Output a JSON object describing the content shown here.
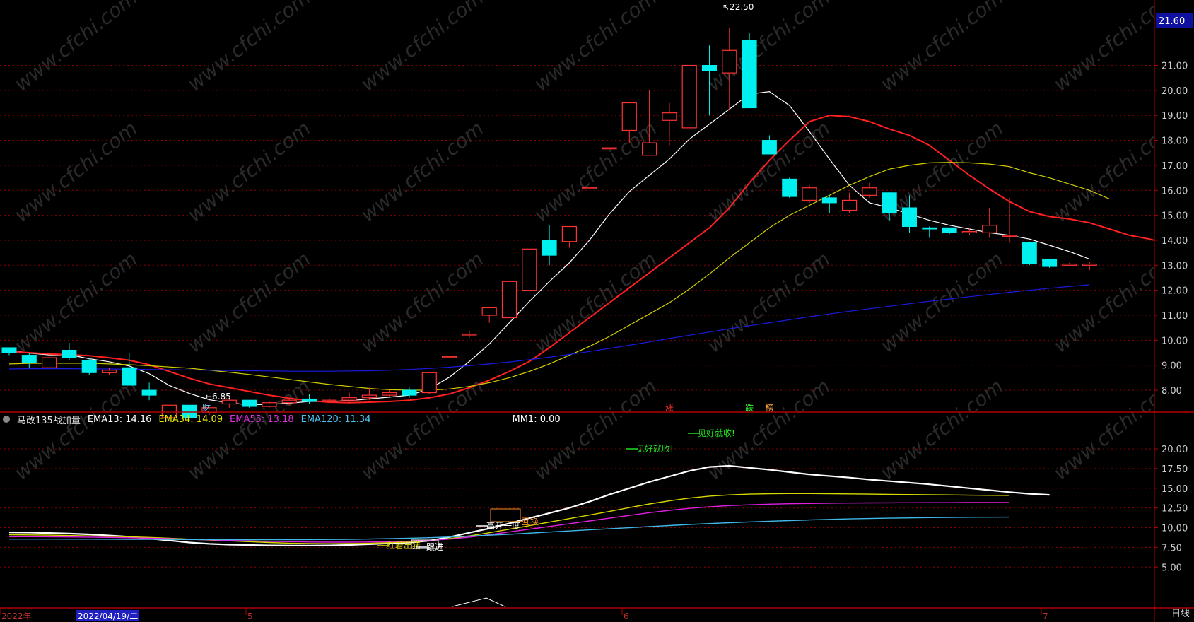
{
  "chart_data": [
    {
      "type": "candlestick",
      "price_axis": {
        "ticks": [
          "21.00",
          "20.00",
          "19.00",
          "18.00",
          "17.00",
          "16.00",
          "15.00",
          "14.00",
          "13.00",
          "12.00",
          "11.00",
          "10.00",
          "9.00",
          "8.00"
        ],
        "tick_values": [
          21,
          20,
          19,
          18,
          17,
          16,
          15,
          14,
          13,
          12,
          11,
          10,
          9,
          8
        ],
        "current_price": "21.60",
        "range": [
          6.4,
          22.8
        ]
      },
      "annotations": {
        "high": "22.50",
        "low": "6.85"
      },
      "candles": [
        {
          "o": 9.7,
          "c": 9.5,
          "h": 9.7,
          "l": 9.4
        },
        {
          "o": 9.4,
          "c": 9.1,
          "h": 9.5,
          "l": 8.9
        },
        {
          "o": 8.9,
          "c": 9.3,
          "h": 9.4,
          "l": 8.8
        },
        {
          "o": 9.6,
          "c": 9.3,
          "h": 9.9,
          "l": 9.2
        },
        {
          "o": 9.2,
          "c": 8.7,
          "h": 9.3,
          "l": 8.6
        },
        {
          "o": 8.7,
          "c": 8.8,
          "h": 8.9,
          "l": 8.6
        },
        {
          "o": 8.9,
          "c": 8.2,
          "h": 9.5,
          "l": 8.2
        },
        {
          "o": 8.0,
          "c": 7.8,
          "h": 8.3,
          "l": 7.6
        },
        {
          "o": 6.9,
          "c": 7.4,
          "h": 7.4,
          "l": 6.9
        },
        {
          "o": 7.4,
          "c": 6.9,
          "h": 7.4,
          "l": 6.85
        },
        {
          "o": 7.1,
          "c": 7.3,
          "h": 7.3,
          "l": 7.0
        },
        {
          "o": 7.45,
          "c": 7.6,
          "h": 7.65,
          "l": 7.3
        },
        {
          "o": 7.6,
          "c": 7.35,
          "h": 7.6,
          "l": 7.3
        },
        {
          "o": 7.35,
          "c": 7.5,
          "h": 7.55,
          "l": 7.3
        },
        {
          "o": 7.5,
          "c": 7.6,
          "h": 7.7,
          "l": 7.4
        },
        {
          "o": 7.65,
          "c": 7.55,
          "h": 7.85,
          "l": 7.45
        },
        {
          "o": 7.55,
          "c": 7.6,
          "h": 7.7,
          "l": 7.45
        },
        {
          "o": 7.6,
          "c": 7.7,
          "h": 7.9,
          "l": 7.5
        },
        {
          "o": 7.7,
          "c": 7.8,
          "h": 8.1,
          "l": 7.6
        },
        {
          "o": 7.8,
          "c": 7.9,
          "h": 8.0,
          "l": 7.75
        },
        {
          "o": 8.0,
          "c": 7.8,
          "h": 8.1,
          "l": 7.7
        },
        {
          "o": 7.9,
          "c": 8.7,
          "h": 8.7,
          "l": 7.85
        },
        {
          "o": 9.35,
          "c": 9.35,
          "h": 9.35,
          "l": 9.35
        },
        {
          "o": 10.25,
          "c": 10.25,
          "h": 10.35,
          "l": 10.1
        },
        {
          "o": 11.0,
          "c": 11.3,
          "h": 11.3,
          "l": 10.7
        },
        {
          "o": 10.9,
          "c": 12.35,
          "h": 12.35,
          "l": 10.9
        },
        {
          "o": 12.0,
          "c": 13.65,
          "h": 13.65,
          "l": 12.0
        },
        {
          "o": 14.0,
          "c": 13.4,
          "h": 14.6,
          "l": 13.0
        },
        {
          "o": 13.95,
          "c": 14.55,
          "h": 14.55,
          "l": 13.7
        },
        {
          "o": 16.1,
          "c": 16.1,
          "h": 16.1,
          "l": 16.1
        },
        {
          "o": 17.7,
          "c": 17.7,
          "h": 17.7,
          "l": 17.7
        },
        {
          "o": 18.4,
          "c": 19.5,
          "h": 19.5,
          "l": 17.9
        },
        {
          "o": 17.4,
          "c": 17.9,
          "h": 20.0,
          "l": 17.4
        },
        {
          "o": 18.8,
          "c": 19.1,
          "h": 19.5,
          "l": 17.8
        },
        {
          "o": 18.5,
          "c": 21.0,
          "h": 21.0,
          "l": 18.5
        },
        {
          "o": 21.0,
          "c": 20.8,
          "h": 21.8,
          "l": 19.0
        },
        {
          "o": 20.7,
          "c": 21.6,
          "h": 22.5,
          "l": 19.2
        },
        {
          "o": 22.0,
          "c": 19.3,
          "h": 22.3,
          "l": 19.3
        },
        {
          "o": 18.0,
          "c": 17.45,
          "h": 18.2,
          "l": 17.45
        },
        {
          "o": 16.45,
          "c": 15.75,
          "h": 16.5,
          "l": 15.7
        },
        {
          "o": 15.6,
          "c": 16.1,
          "h": 16.2,
          "l": 15.5
        },
        {
          "o": 15.7,
          "c": 15.5,
          "h": 15.8,
          "l": 15.1
        },
        {
          "o": 15.2,
          "c": 15.6,
          "h": 15.9,
          "l": 15.1
        },
        {
          "o": 15.8,
          "c": 16.1,
          "h": 16.3,
          "l": 15.7
        },
        {
          "o": 15.9,
          "c": 15.1,
          "h": 15.95,
          "l": 14.8
        },
        {
          "o": 15.3,
          "c": 14.55,
          "h": 15.8,
          "l": 14.3
        },
        {
          "o": 14.5,
          "c": 14.45,
          "h": 14.55,
          "l": 14.1
        },
        {
          "o": 14.5,
          "c": 14.3,
          "h": 14.5,
          "l": 14.25
        },
        {
          "o": 14.3,
          "c": 14.35,
          "h": 14.5,
          "l": 14.2
        },
        {
          "o": 14.3,
          "c": 14.6,
          "h": 15.3,
          "l": 14.1
        },
        {
          "o": 14.2,
          "c": 14.2,
          "h": 15.7,
          "l": 13.9
        },
        {
          "o": 13.9,
          "c": 13.05,
          "h": 13.95,
          "l": 13.0
        },
        {
          "o": 13.25,
          "c": 12.95,
          "h": 13.25,
          "l": 12.9
        },
        {
          "o": 13.0,
          "c": 13.05,
          "h": 13.1,
          "l": 12.95
        },
        {
          "o": 13.0,
          "c": 13.05,
          "h": 13.15,
          "l": 12.8
        }
      ],
      "moving_averages": [
        {
          "color": "#ffffff",
          "values": [
            9.62,
            9.48,
            9.41,
            9.42,
            9.26,
            9.14,
            8.97,
            8.66,
            8.19,
            7.87,
            7.62,
            7.49,
            7.42,
            7.43,
            7.48,
            7.55,
            7.55,
            7.58,
            7.65,
            7.72,
            7.8,
            8.05,
            8.52,
            9.15,
            9.85,
            10.7,
            11.55,
            12.35,
            13.1,
            14.0,
            15.05,
            15.95,
            16.6,
            17.25,
            18.05,
            18.65,
            19.25,
            19.85,
            19.95,
            19.4,
            18.35,
            17.25,
            16.2,
            15.5,
            15.3,
            15.05,
            14.8,
            14.6,
            14.45,
            14.3,
            14.2,
            14.05,
            13.8,
            13.55,
            13.25
          ]
        },
        {
          "color": "#ff2020",
          "values": [
            9.55,
            9.5,
            9.45,
            9.42,
            9.38,
            9.3,
            9.2,
            9.02,
            8.75,
            8.48,
            8.25,
            8.1,
            7.95,
            7.8,
            7.68,
            7.58,
            7.52,
            7.5,
            7.52,
            7.55,
            7.6,
            7.7,
            7.85,
            8.1,
            8.4,
            8.75,
            9.15,
            9.7,
            10.3,
            10.9,
            11.5,
            12.1,
            12.7,
            13.3,
            13.9,
            14.5,
            15.3,
            16.3,
            17.2,
            18.0,
            18.75,
            19.0,
            18.95,
            18.75,
            18.45,
            18.2,
            17.8,
            17.2,
            16.6,
            16.05,
            15.55,
            15.15,
            14.95,
            14.85,
            14.7,
            14.45,
            14.2,
            14.05,
            13.85
          ]
        },
        {
          "color": "#d0d000",
          "values": [
            9.05,
            9.07,
            9.08,
            9.08,
            9.08,
            9.05,
            9.02,
            8.98,
            8.93,
            8.88,
            8.8,
            8.72,
            8.63,
            8.53,
            8.43,
            8.33,
            8.23,
            8.15,
            8.07,
            8.02,
            8.0,
            8.0,
            8.05,
            8.15,
            8.3,
            8.5,
            8.75,
            9.05,
            9.4,
            9.75,
            10.15,
            10.6,
            11.05,
            11.5,
            12.05,
            12.65,
            13.3,
            13.9,
            14.5,
            15.0,
            15.4,
            15.8,
            16.2,
            16.55,
            16.85,
            17.0,
            17.1,
            17.12,
            17.1,
            17.05,
            16.95,
            16.7,
            16.5,
            16.25,
            16.0,
            15.65
          ]
        },
        {
          "color": "#1a1ae0",
          "values": [
            8.85,
            8.86,
            8.86,
            8.86,
            8.85,
            8.85,
            8.84,
            8.83,
            8.82,
            8.81,
            8.8,
            8.79,
            8.78,
            8.77,
            8.76,
            8.76,
            8.76,
            8.77,
            8.78,
            8.8,
            8.83,
            8.87,
            8.92,
            8.98,
            9.05,
            9.13,
            9.22,
            9.32,
            9.43,
            9.55,
            9.67,
            9.8,
            9.93,
            10.07,
            10.2,
            10.33,
            10.46,
            10.58,
            10.7,
            10.82,
            10.94,
            11.05,
            11.16,
            11.26,
            11.36,
            11.46,
            11.56,
            11.65,
            11.74,
            11.83,
            11.92,
            12.0,
            12.08,
            12.15,
            12.22
          ]
        }
      ],
      "event_markers": [
        {
          "text": "涨",
          "index": 33,
          "color": "#ff3030"
        },
        {
          "text": "跌",
          "index": 37,
          "color": "#30ff30"
        },
        {
          "text": "榜",
          "index": 38,
          "color": "#ffa040"
        }
      ],
      "event_marker_left": "财"
    },
    {
      "type": "line",
      "legend": {
        "title": "马改135战加量",
        "ema13": "EMA13: 14.16",
        "ema34": "EMA34: 14.09",
        "ema55": "EMA55: 13.18",
        "ema120": "EMA120: 11.34",
        "mm1": "MM1: 0.00"
      },
      "y_ticks": [
        "20.00",
        "17.50",
        "15.00",
        "12.50",
        "10.00",
        "7.50",
        "5.00"
      ],
      "y_tick_values": [
        20,
        17.5,
        15,
        12.5,
        10,
        7.5,
        5
      ],
      "y_range": [
        1.5,
        23.5
      ],
      "series": [
        {
          "color": "#ffffff",
          "values": [
            9.4,
            9.38,
            9.32,
            9.25,
            9.15,
            9.0,
            8.85,
            8.62,
            8.38,
            8.12,
            7.95,
            7.85,
            7.8,
            7.75,
            7.72,
            7.72,
            7.75,
            7.8,
            7.9,
            8.0,
            8.1,
            8.35,
            8.8,
            9.35,
            9.9,
            10.55,
            11.2,
            11.85,
            12.5,
            13.3,
            14.2,
            15.0,
            15.8,
            16.5,
            17.2,
            17.7,
            17.85,
            17.6,
            17.35,
            17.05,
            16.75,
            16.55,
            16.35,
            16.1,
            15.9,
            15.7,
            15.5,
            15.25,
            15.0,
            14.75,
            14.5,
            14.3,
            14.16
          ]
        },
        {
          "color": "#d8d800",
          "values": [
            9.1,
            9.08,
            9.05,
            9.0,
            8.95,
            8.9,
            8.84,
            8.76,
            8.66,
            8.54,
            8.42,
            8.32,
            8.22,
            8.12,
            8.04,
            7.98,
            7.96,
            7.98,
            8.02,
            8.1,
            8.2,
            8.35,
            8.6,
            8.95,
            9.35,
            9.8,
            10.25,
            10.7,
            11.15,
            11.6,
            12.05,
            12.55,
            13.0,
            13.4,
            13.75,
            14.0,
            14.15,
            14.25,
            14.3,
            14.32,
            14.32,
            14.3,
            14.28,
            14.25,
            14.22,
            14.2,
            14.17,
            14.15,
            14.12,
            14.1,
            14.09
          ]
        },
        {
          "color": "#e020e0",
          "values": [
            8.85,
            8.85,
            8.84,
            8.82,
            8.8,
            8.76,
            8.72,
            8.66,
            8.6,
            8.52,
            8.45,
            8.38,
            8.32,
            8.26,
            8.22,
            8.18,
            8.16,
            8.16,
            8.18,
            8.22,
            8.28,
            8.38,
            8.55,
            8.8,
            9.1,
            9.45,
            9.8,
            10.15,
            10.5,
            10.85,
            11.2,
            11.55,
            11.9,
            12.2,
            12.45,
            12.65,
            12.8,
            12.9,
            12.98,
            13.03,
            13.07,
            13.1,
            13.12,
            13.14,
            13.15,
            13.16,
            13.17,
            13.17,
            13.18,
            13.18,
            13.18
          ]
        },
        {
          "color": "#40b8e8",
          "values": [
            8.55,
            8.55,
            8.55,
            8.54,
            8.54,
            8.53,
            8.52,
            8.51,
            8.5,
            8.49,
            8.48,
            8.48,
            8.47,
            8.47,
            8.47,
            8.48,
            8.5,
            8.52,
            8.56,
            8.6,
            8.66,
            8.73,
            8.82,
            8.92,
            9.04,
            9.16,
            9.3,
            9.44,
            9.58,
            9.72,
            9.86,
            10.0,
            10.14,
            10.27,
            10.4,
            10.52,
            10.63,
            10.73,
            10.82,
            10.9,
            10.98,
            11.05,
            11.11,
            11.16,
            11.2,
            11.24,
            11.27,
            11.3,
            11.32,
            11.33,
            11.34
          ]
        }
      ],
      "signals": [
        {
          "text": "见好就收!",
          "color": "#20e020"
        },
        {
          "text": "见好就收!",
          "color": "#20e020"
        },
        {
          "text": "高开一度",
          "color": "#ffffff"
        },
        {
          "text": "互换",
          "color": "#ff9020"
        },
        {
          "text": "红着出猪",
          "color": "#d8d800"
        },
        {
          "text": "跟进",
          "color": "#ffffff"
        }
      ]
    }
  ],
  "time_axis": {
    "labels": [
      "2022年",
      "2022/04/19/二",
      "5",
      "6",
      "7"
    ],
    "period": "日线"
  },
  "watermark": "www.cfchi.com",
  "colors": {
    "up": "#ff3232",
    "down": "#00f0f0",
    "grid": "#8a0000",
    "axis": "#b00000"
  }
}
